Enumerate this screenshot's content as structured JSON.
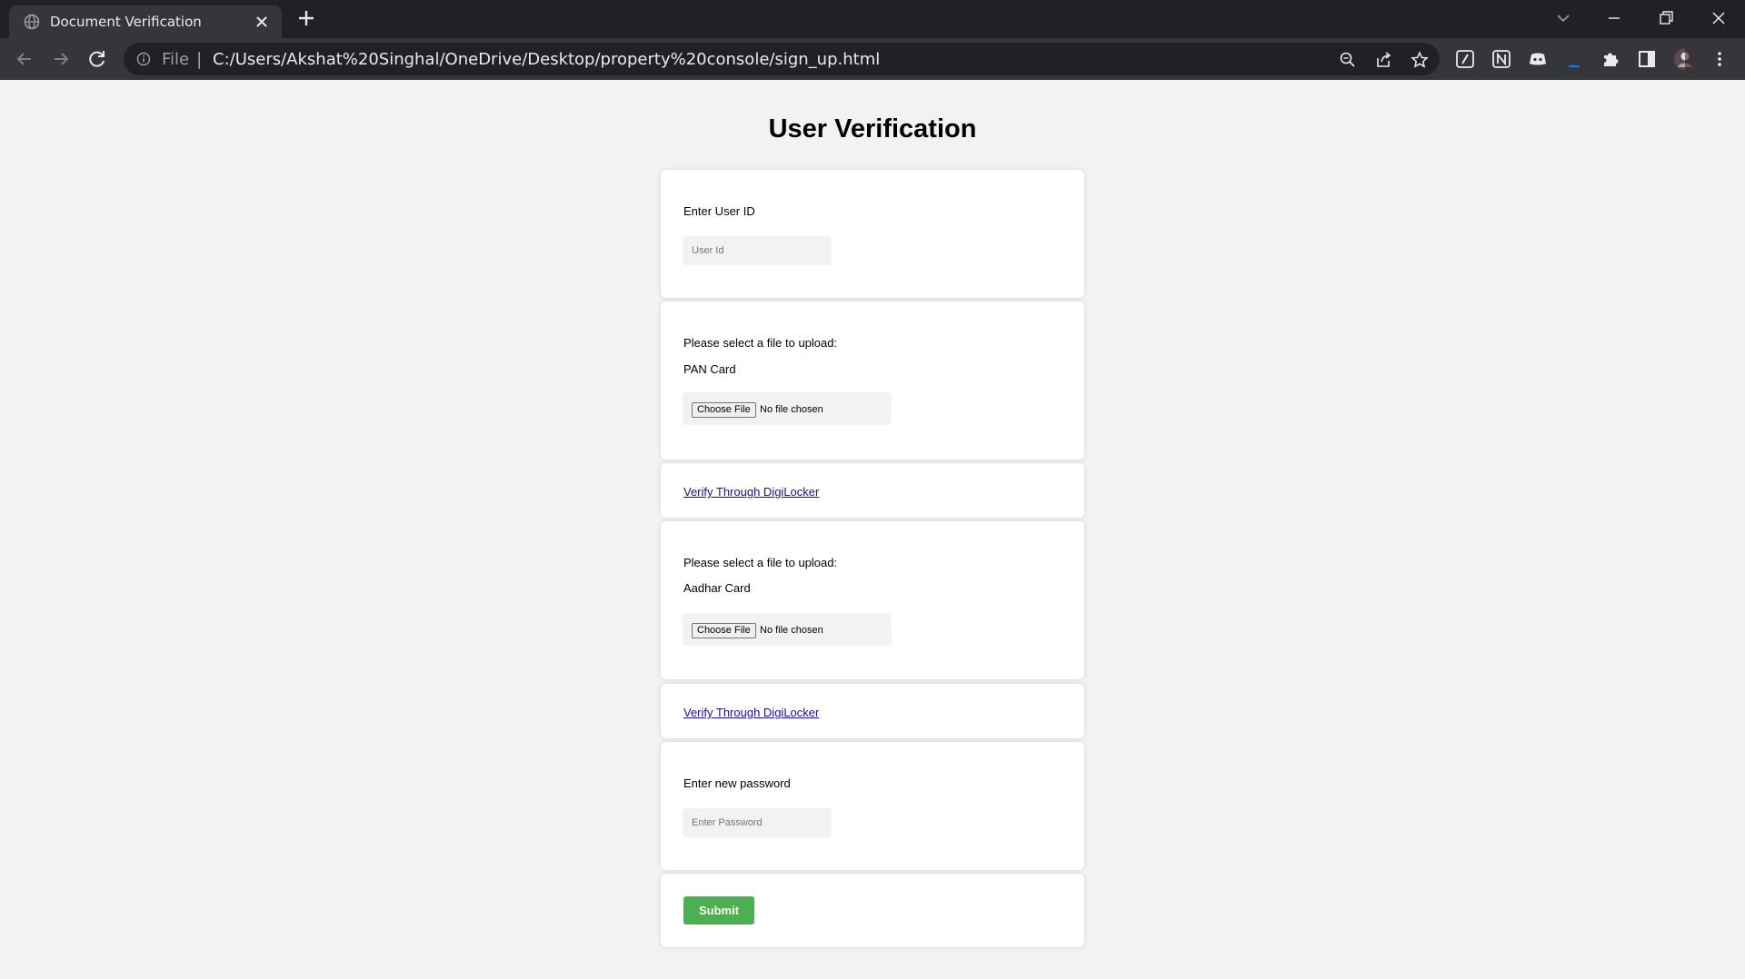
{
  "browser": {
    "tab_title": "Document Verification",
    "address_scheme": "File",
    "address_separator": "|",
    "url": "C:/Users/Akshat%20Singhal/OneDrive/Desktop/property%20console/sign_up.html"
  },
  "page": {
    "title": "User Verification",
    "user_id": {
      "label": "Enter User ID",
      "placeholder": "User Id"
    },
    "pan": {
      "prompt": "Please select a file to upload:",
      "doc_label": "PAN Card",
      "choose_label": "Choose File",
      "status": "No file chosen",
      "digilocker_link": "Verify Through DigiLocker"
    },
    "aadhar": {
      "prompt": "Please select a file to upload:",
      "doc_label": "Aadhar Card",
      "choose_label": "Choose File",
      "status": "No file chosen",
      "digilocker_link": "Verify Through DigiLocker"
    },
    "password": {
      "label": "Enter new password",
      "placeholder": "Enter Password"
    },
    "submit_label": "Submit"
  },
  "colors": {
    "page_background": "#f2f2f2",
    "submit_button": "#4caf50",
    "link": "#1a0dab",
    "browser_frame": "#202124",
    "browser_toolbar": "#35363a"
  },
  "icons": [
    "globe-icon",
    "close-icon",
    "plus-icon",
    "chevron-down-icon",
    "minimize-icon",
    "restore-icon",
    "back-icon",
    "forward-icon",
    "reload-icon",
    "info-icon",
    "zoom-icon",
    "share-icon",
    "star-icon",
    "extension-notion-icon",
    "extension-discord-icon",
    "puzzle-icon",
    "side-panel-icon",
    "avatar",
    "kebab-menu-icon"
  ]
}
